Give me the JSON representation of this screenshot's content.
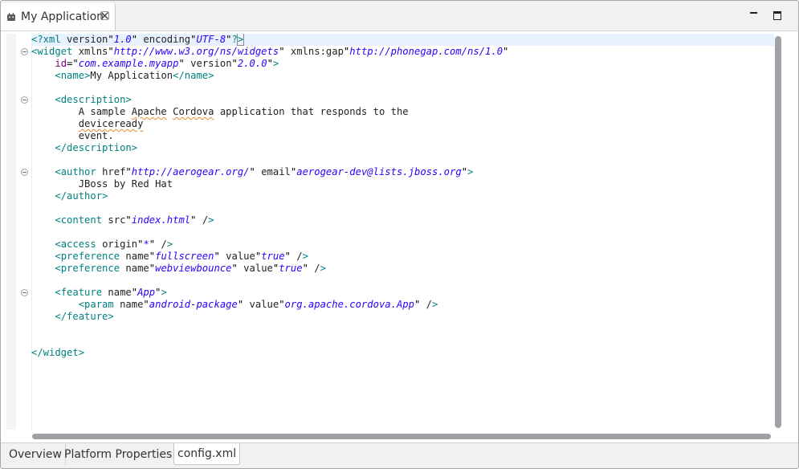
{
  "editor_tab": {
    "title": "My Application",
    "icon": "cordova-robot-icon",
    "close_glyph": "⊘"
  },
  "window_controls": [
    "minimize-icon",
    "maximize-icon"
  ],
  "code_lines": [
    "<?xml version=\"1.0\" encoding=\"UTF-8\"?>",
    "<widget xmlns=\"http://www.w3.org/ns/widgets\" xmlns:gap=\"http://phonegap.com/ns/1.0\"",
    "    id=\"com.example.myapp\" version=\"2.0.0\">",
    "    <name>My Application</name>",
    "",
    "    <description>",
    "        A sample Apache Cordova application that responds to the",
    "        deviceready",
    "        event.",
    "    </description>",
    "",
    "    <author href=\"http://aerogear.org/\" email=\"aerogear-dev@lists.jboss.org\">",
    "        JBoss by Red Hat",
    "    </author>",
    "",
    "    <content src=\"index.html\" />",
    "",
    "    <access origin=\"*\" />",
    "    <preference name=\"fullscreen\" value=\"true\" />",
    "    <preference name=\"webviewbounce\" value=\"true\" />",
    "",
    "    <feature name=\"App\">",
    "        <param name=\"android-package\" value=\"org.apache.cordova.App\" />",
    "    </feature>",
    "",
    "",
    "</widget>"
  ],
  "fold_lines": [
    2,
    6,
    12,
    22
  ],
  "bottom_tabs": [
    {
      "label": "Overview",
      "active": false
    },
    {
      "label": "Platform Properties",
      "active": false
    },
    {
      "label": "config.xml",
      "active": true
    }
  ],
  "colors": {
    "tag": "#008080",
    "attribute": "#7f007f",
    "value": "#2a00ff",
    "current_line": "#e8f2fe"
  }
}
